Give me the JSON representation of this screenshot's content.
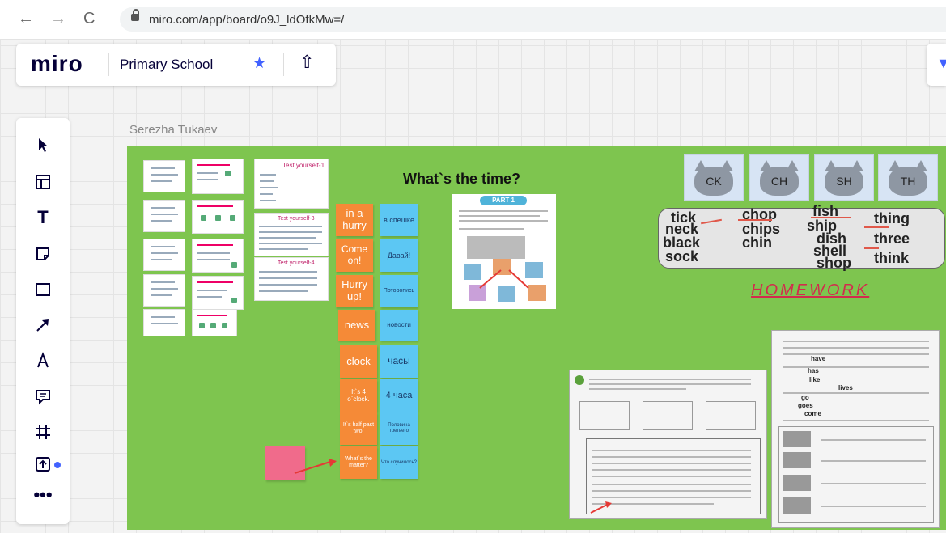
{
  "browser": {
    "url": "miro.com/app/board/o9J_ldOfkMw=/"
  },
  "header": {
    "logo": "miro",
    "board_name": "Primary School"
  },
  "board": {
    "author": "Serezha Tukaev",
    "title": "What`s the time?",
    "worksheet_badge": "PART 1",
    "cards": [
      {
        "en": "in a hurry",
        "ru": "в спешке"
      },
      {
        "en": "Come on!",
        "ru": "Давай!"
      },
      {
        "en": "Hurry up!",
        "ru": "Поторопись"
      },
      {
        "en": "news",
        "ru": "новости"
      },
      {
        "en": "clock",
        "ru": "часы"
      },
      {
        "en": "It`s 4 o`clock.",
        "ru": "4 часа"
      },
      {
        "en": "It`s half past two.",
        "ru": "Половина третьего"
      },
      {
        "en": "What`s the matter?",
        "ru": "Что случилось?"
      }
    ],
    "cats": [
      "CK",
      "CH",
      "SH",
      "TH"
    ],
    "words": {
      "ck": [
        "tick",
        "neck",
        "black",
        "sock"
      ],
      "ch": [
        "chop",
        "chips",
        "chin"
      ],
      "sh": [
        "fish",
        "ship",
        "dish",
        "shell",
        "shop"
      ],
      "th": [
        "thing",
        "three",
        "think"
      ]
    },
    "homework_label": "HOMEWORK",
    "handwritten": [
      "have",
      "has",
      "like",
      "lives",
      "go",
      "goes",
      "come"
    ],
    "test_titles": [
      "Test yourself-1",
      "Test yourself-3",
      "Test yourself-4"
    ]
  },
  "colors": {
    "board_green": "#7ec54f",
    "sticky_orange": "#f58a37",
    "sticky_blue": "#5cc7f3",
    "accent": "#4262ff",
    "homework": "#d22c4d"
  }
}
